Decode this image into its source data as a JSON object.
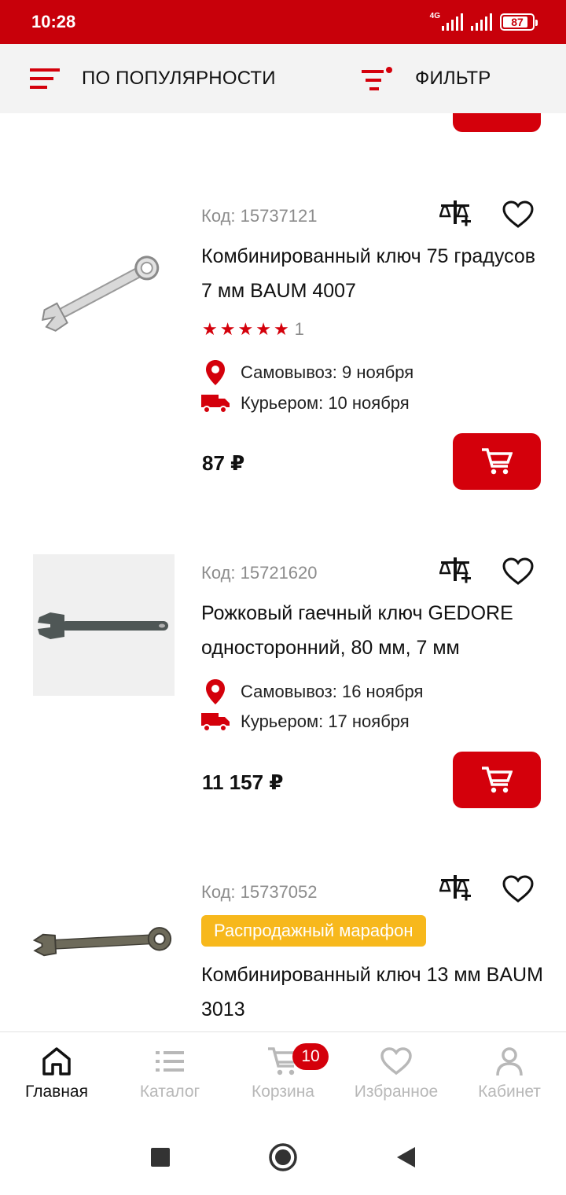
{
  "status_bar": {
    "time": "10:28",
    "network": "4G",
    "battery": 87
  },
  "toolbar": {
    "sort_label": "ПО ПОПУЛЯРНОСТИ",
    "filter_label": "ФИЛЬТР"
  },
  "products": [
    {
      "code": "Код: 15737121",
      "title": "Комбинированный ключ 75 градусов 7 мм BAUM 4007",
      "rating": 5,
      "reviews": "1",
      "pickup": "Самовывоз: 9 ноября",
      "courier": "Курьером: 10 ноября",
      "price": "87 ₽"
    },
    {
      "code": "Код: 15721620",
      "title": "Рожковый гаечный ключ GEDORE односторонний, 80 мм, 7 мм",
      "pickup": "Самовывоз: 16 ноября",
      "courier": "Курьером: 17 ноября",
      "price": "11 157 ₽"
    },
    {
      "code": "Код: 15737052",
      "badge": "Распродажный марафон",
      "title": "Комбинированный ключ 13 мм BAUM 3013"
    }
  ],
  "bottom_nav": {
    "items": [
      {
        "label": "Главная",
        "icon": "home-icon"
      },
      {
        "label": "Каталог",
        "icon": "list-icon"
      },
      {
        "label": "Корзина",
        "icon": "cart-icon",
        "badge": "10"
      },
      {
        "label": "Избранное",
        "icon": "heart-icon"
      },
      {
        "label": "Кабинет",
        "icon": "user-icon"
      }
    ]
  },
  "colors": {
    "brand": "#c8000a",
    "accent": "#d4000b",
    "promo": "#f7b81c"
  }
}
